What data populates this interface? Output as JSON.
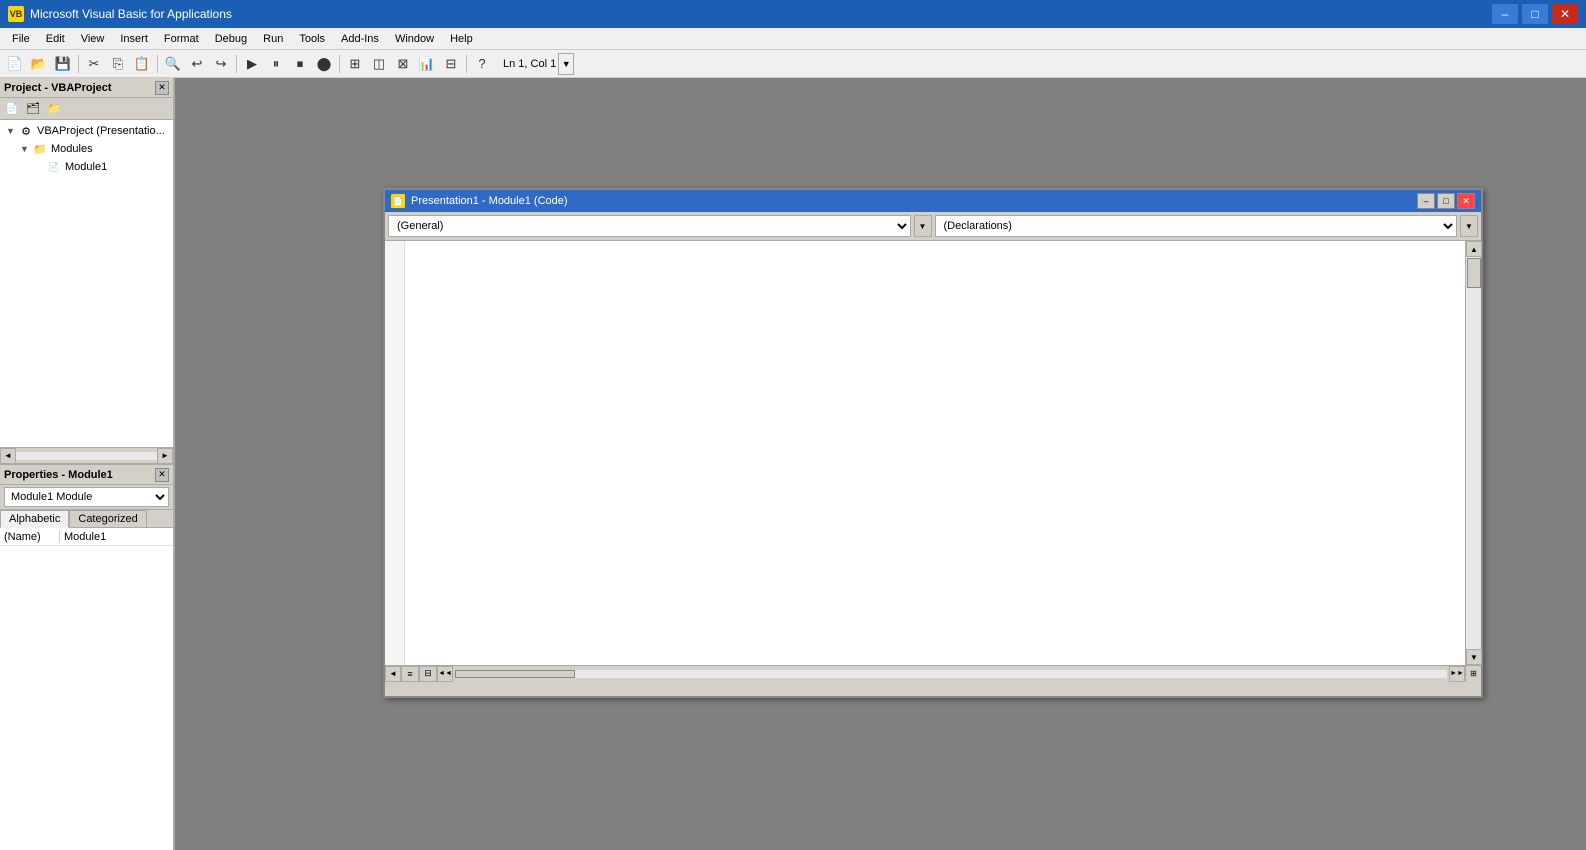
{
  "app": {
    "title": "Microsoft Visual Basic for Applications",
    "icon": "VB"
  },
  "titlebar": {
    "minimize_label": "–",
    "maximize_label": "□",
    "close_label": "✕"
  },
  "menu": {
    "items": [
      {
        "label": "File",
        "id": "file"
      },
      {
        "label": "Edit",
        "id": "edit"
      },
      {
        "label": "View",
        "id": "view"
      },
      {
        "label": "Insert",
        "id": "insert"
      },
      {
        "label": "Format",
        "id": "format"
      },
      {
        "label": "Debug",
        "id": "debug"
      },
      {
        "label": "Run",
        "id": "run"
      },
      {
        "label": "Tools",
        "id": "tools"
      },
      {
        "label": "Add-Ins",
        "id": "addins"
      },
      {
        "label": "Window",
        "id": "window"
      },
      {
        "label": "Help",
        "id": "help"
      }
    ]
  },
  "toolbar": {
    "status": "Ln 1, Col 1",
    "icons": [
      {
        "id": "new",
        "symbol": "📄"
      },
      {
        "id": "open",
        "symbol": "📂"
      },
      {
        "id": "save",
        "symbol": "💾"
      },
      {
        "id": "cut",
        "symbol": "✂"
      },
      {
        "id": "copy",
        "symbol": "📋"
      },
      {
        "id": "paste",
        "symbol": "📌"
      },
      {
        "id": "find",
        "symbol": "🔍"
      },
      {
        "id": "undo",
        "symbol": "↩"
      },
      {
        "id": "redo",
        "symbol": "↪"
      },
      {
        "id": "run",
        "symbol": "▶"
      },
      {
        "id": "pause",
        "symbol": "⏸"
      },
      {
        "id": "stop",
        "symbol": "⏹"
      },
      {
        "id": "toggle-breakpoint",
        "symbol": "🔴"
      },
      {
        "id": "design",
        "symbol": "📐"
      },
      {
        "id": "object-browser",
        "symbol": "📦"
      },
      {
        "id": "toolbox",
        "symbol": "🧰"
      },
      {
        "id": "help",
        "symbol": "?"
      }
    ]
  },
  "project_panel": {
    "title": "Project - VBAProject",
    "close_label": "✕",
    "toolbar_icons": [
      "📁",
      "🗂",
      "📄"
    ],
    "tree": {
      "root": {
        "label": "VBAProject (Presentatio...",
        "icon": "⚙"
      },
      "modules_folder": {
        "label": "Modules",
        "icon": "📁"
      },
      "module1": {
        "label": "Module1",
        "icon": "📄"
      }
    }
  },
  "properties_panel": {
    "title": "Properties - Module1",
    "close_label": "✕",
    "dropdown_value": "Module1  Module",
    "tabs": {
      "alphabetic": "Alphabetic",
      "categorized": "Categorized"
    },
    "properties": [
      {
        "name": "(Name)",
        "value": "Module1"
      }
    ]
  },
  "code_window": {
    "title": "Presentation1 - Module1 (Code)",
    "icon": "📄",
    "minimize_label": "–",
    "maximize_label": "□",
    "close_label": "✕",
    "context_dropdown": "(General)",
    "proc_dropdown": "(Declarations)",
    "code_content": ""
  }
}
